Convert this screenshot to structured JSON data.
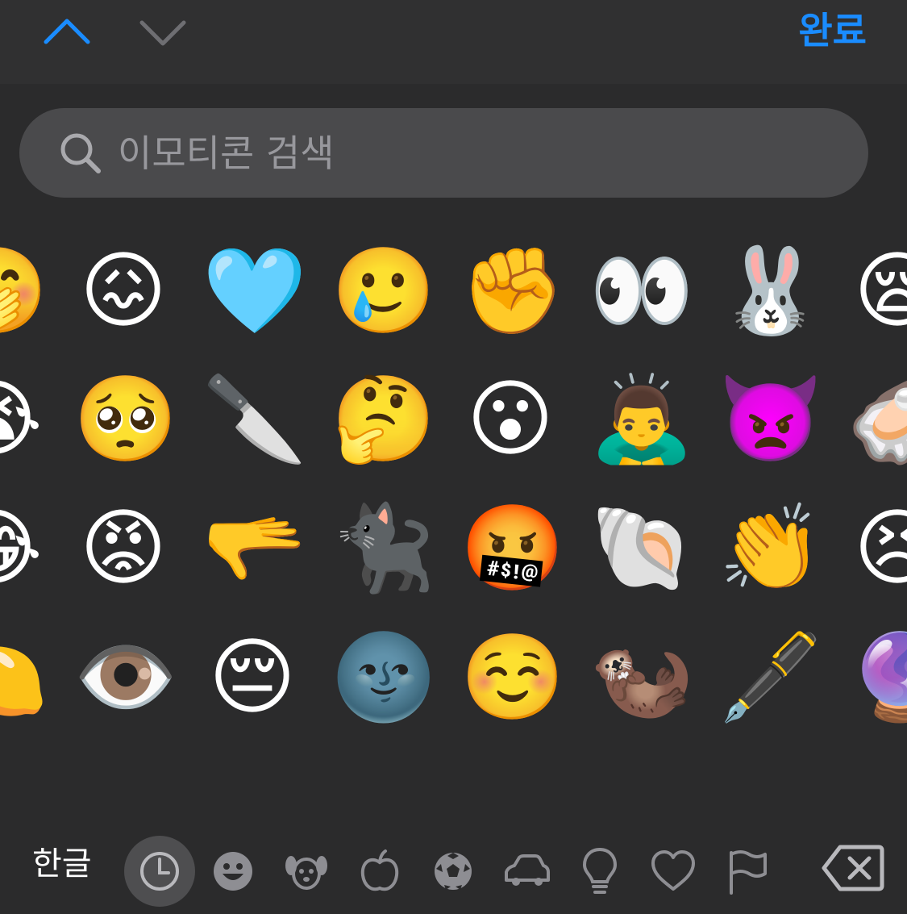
{
  "toolbar": {
    "done_label": "완료",
    "accent_color": "#1a8cff",
    "up_icon": "chevron-up-icon",
    "down_icon": "chevron-down-icon"
  },
  "search": {
    "placeholder": "이모티콘 검색",
    "value": "",
    "icon": "magnifier-icon"
  },
  "emoji_rows": [
    [
      "🤭",
      "😖",
      "🩵",
      "🥲",
      "✊",
      "👀",
      "🐰",
      "😪"
    ],
    [
      "😭",
      "🥺",
      "🔪",
      "🤔",
      "😮",
      "🙇‍♂️",
      "👿",
      "🦪"
    ],
    [
      "😂",
      "😡",
      "🫳",
      "🐈‍⬛",
      "🤬",
      "🐚",
      "👏",
      "😣"
    ],
    [
      "🍋",
      "👁️",
      "😔",
      "🌚",
      "☺️",
      "🦦",
      "🖋️",
      "🔮"
    ]
  ],
  "category_bar": {
    "keyboard_switch_label": "한글",
    "categories": [
      {
        "name": "recent",
        "icon": "clock-icon",
        "active": true
      },
      {
        "name": "smileys",
        "icon": "smiley-icon",
        "active": false
      },
      {
        "name": "animals",
        "icon": "dog-icon",
        "active": false
      },
      {
        "name": "food",
        "icon": "apple-icon",
        "active": false
      },
      {
        "name": "activity",
        "icon": "soccer-ball-icon",
        "active": false
      },
      {
        "name": "travel",
        "icon": "car-icon",
        "active": false
      },
      {
        "name": "objects",
        "icon": "lightbulb-icon",
        "active": false
      },
      {
        "name": "symbols",
        "icon": "heart-icon",
        "active": false
      },
      {
        "name": "flags",
        "icon": "flag-icon",
        "active": false
      }
    ],
    "delete_icon": "backspace-icon"
  }
}
